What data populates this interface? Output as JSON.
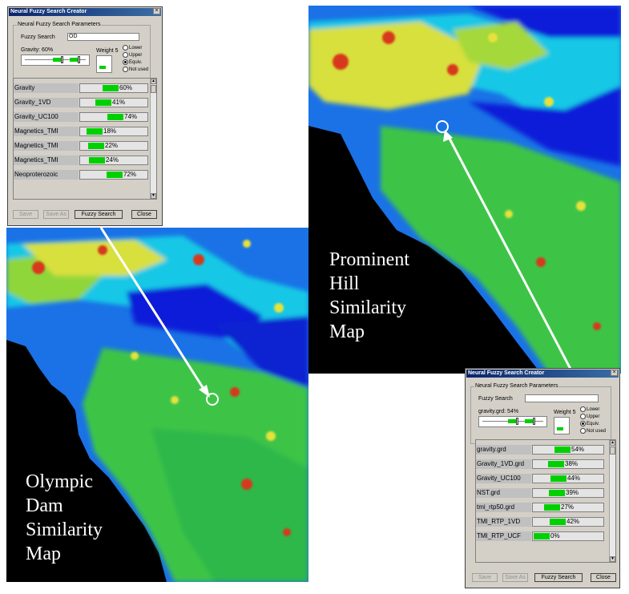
{
  "maps": {
    "olympic": {
      "label": "Olympic\nDam\nSimilarity\nMap"
    },
    "prominent": {
      "label": "Prominent\nHill\nSimilarity\nMap"
    }
  },
  "dialog_top": {
    "title": "Neural Fuzzy Search Creator",
    "close_glyph": "×",
    "group_title": "Neural Fuzzy Search Parameters",
    "fuzzy_search_label": "Fuzzy Search",
    "fuzzy_search_value": "OD",
    "gravity_label": "Gravity: 60%",
    "weight_label": "Weight 5",
    "radio": [
      "Lower",
      "Upper",
      "Equiv.",
      "Not used"
    ],
    "selected_radio": "Equiv.",
    "rows": [
      {
        "name": "Gravity",
        "pct": "60%",
        "value": 60
      },
      {
        "name": "Gravity_1VD",
        "pct": "41%",
        "value": 41
      },
      {
        "name": "Gravity_UC100",
        "pct": "74%",
        "value": 74
      },
      {
        "name": "Magnetics_TMI",
        "pct": "18%",
        "value": 18
      },
      {
        "name": "Magnetics_TMI",
        "pct": "22%",
        "value": 22
      },
      {
        "name": "Magnetics_TMI",
        "pct": "24%",
        "value": 24
      },
      {
        "name": "Neoproterozoic",
        "pct": "72%",
        "value": 72
      }
    ],
    "buttons": {
      "save": "Save",
      "save_as": "Save As",
      "fuzzy_search": "Fuzzy Search",
      "close": "Close"
    }
  },
  "dialog_bottom": {
    "title": "Neural Fuzzy Search Creator",
    "close_glyph": "×",
    "group_title": "Neural Fuzzy Search Parameters",
    "fuzzy_search_label": "Fuzzy Search",
    "fuzzy_search_value": "",
    "gravity_label": "gravity.grd: 54%",
    "weight_label": "Weight 5",
    "radio": [
      "Lower",
      "Upper",
      "Equiv.",
      "Not used"
    ],
    "selected_radio": "Equiv.",
    "rows": [
      {
        "name": "gravity.grd",
        "pct": "54%",
        "value": 54
      },
      {
        "name": "Gravity_1VD.grd",
        "pct": "38%",
        "value": 38
      },
      {
        "name": "Gravity_UC100",
        "pct": "44%",
        "value": 44
      },
      {
        "name": "NST.grd",
        "pct": "39%",
        "value": 39
      },
      {
        "name": "tmi_rtp50.grd",
        "pct": "27%",
        "value": 27
      },
      {
        "name": "TMI_RTP_1VD",
        "pct": "42%",
        "value": 42
      },
      {
        "name": "TMI_RTP_UCF",
        "pct": "0%",
        "value": 0
      }
    ],
    "buttons": {
      "save": "Save",
      "save_as": "Save As",
      "fuzzy_search": "Fuzzy Search",
      "close": "Close"
    }
  },
  "colors": {
    "map_black": "#000000",
    "deep_blue": "#0a18d0",
    "cyan": "#16c8e8",
    "green": "#34c43a",
    "yellow": "#e6e23a",
    "red": "#d8381c",
    "bar_green": "#00d000",
    "dialog_gray": "#d4d0c8",
    "titlebar_blue": "#0a246a"
  }
}
